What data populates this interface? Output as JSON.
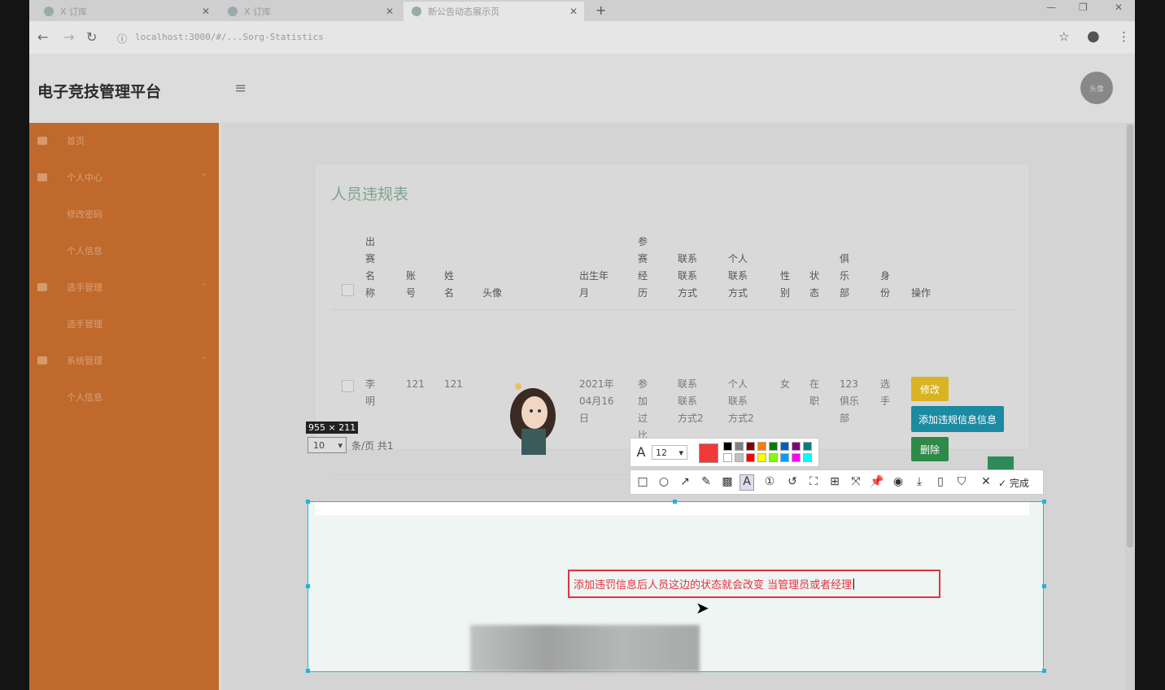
{
  "browser": {
    "tabs": [
      {
        "title": "X 订库",
        "close": "✕"
      },
      {
        "title": "X 订库",
        "close": "✕"
      },
      {
        "title": "新公告动态展示页",
        "close": "✕"
      }
    ],
    "new_tab": "+",
    "url": "localhost:3000/#/...Sorg-Statistics"
  },
  "app": {
    "brand": "电子竞技管理平台",
    "avatar_text": "头像"
  },
  "sidebar": {
    "items": [
      {
        "label": "首页",
        "sub": false
      },
      {
        "label": "个人中心",
        "sub": false
      },
      {
        "label": "修改密码",
        "sub": true
      },
      {
        "label": "个人信息",
        "sub": true
      },
      {
        "label": "选手管理",
        "sub": false
      },
      {
        "label": "选手管理",
        "sub": true
      },
      {
        "label": "系统管理",
        "sub": false
      },
      {
        "label": "个人信息",
        "sub": true
      }
    ]
  },
  "table": {
    "title": "人员违规表",
    "headers": [
      "出赛名称",
      "账号",
      "姓名",
      "头像",
      "出生年月",
      "参赛经历",
      "联系联系方式",
      "个人联系方式",
      "性别",
      "状态",
      "俱乐部",
      "身份",
      "操作"
    ],
    "row": {
      "name": "李明",
      "account": "121",
      "nickname": "121",
      "birth": "2021年04月16日",
      "experience": "参加过比赛",
      "contact": "联系联系方式2",
      "personal_contact": "个人联系方式2",
      "gender": "女",
      "status": "在职",
      "club": "123俱乐部",
      "role": "选手"
    },
    "actions": [
      "修改",
      "添加违规信息信息",
      "删除"
    ],
    "pager_select": "10",
    "pager_text": "条/页 共1"
  },
  "screenshot_tool": {
    "dimension_label": "955 × 211",
    "font_size": "12",
    "current_color": "#f03a3a",
    "palette": [
      "#000000",
      "#808080",
      "#800000",
      "#ff8000",
      "#008000",
      "#0060c0",
      "#800080",
      "#008080",
      "#ffffff",
      "#c0c0c0",
      "#ff0000",
      "#ffff00",
      "#80ff00",
      "#00a0ff",
      "#ff00ff",
      "#00ffff"
    ],
    "finish_label": "完成",
    "typed_text": "添加违罚信息后人员这边的状态就会改变 当管理员或者经理"
  }
}
